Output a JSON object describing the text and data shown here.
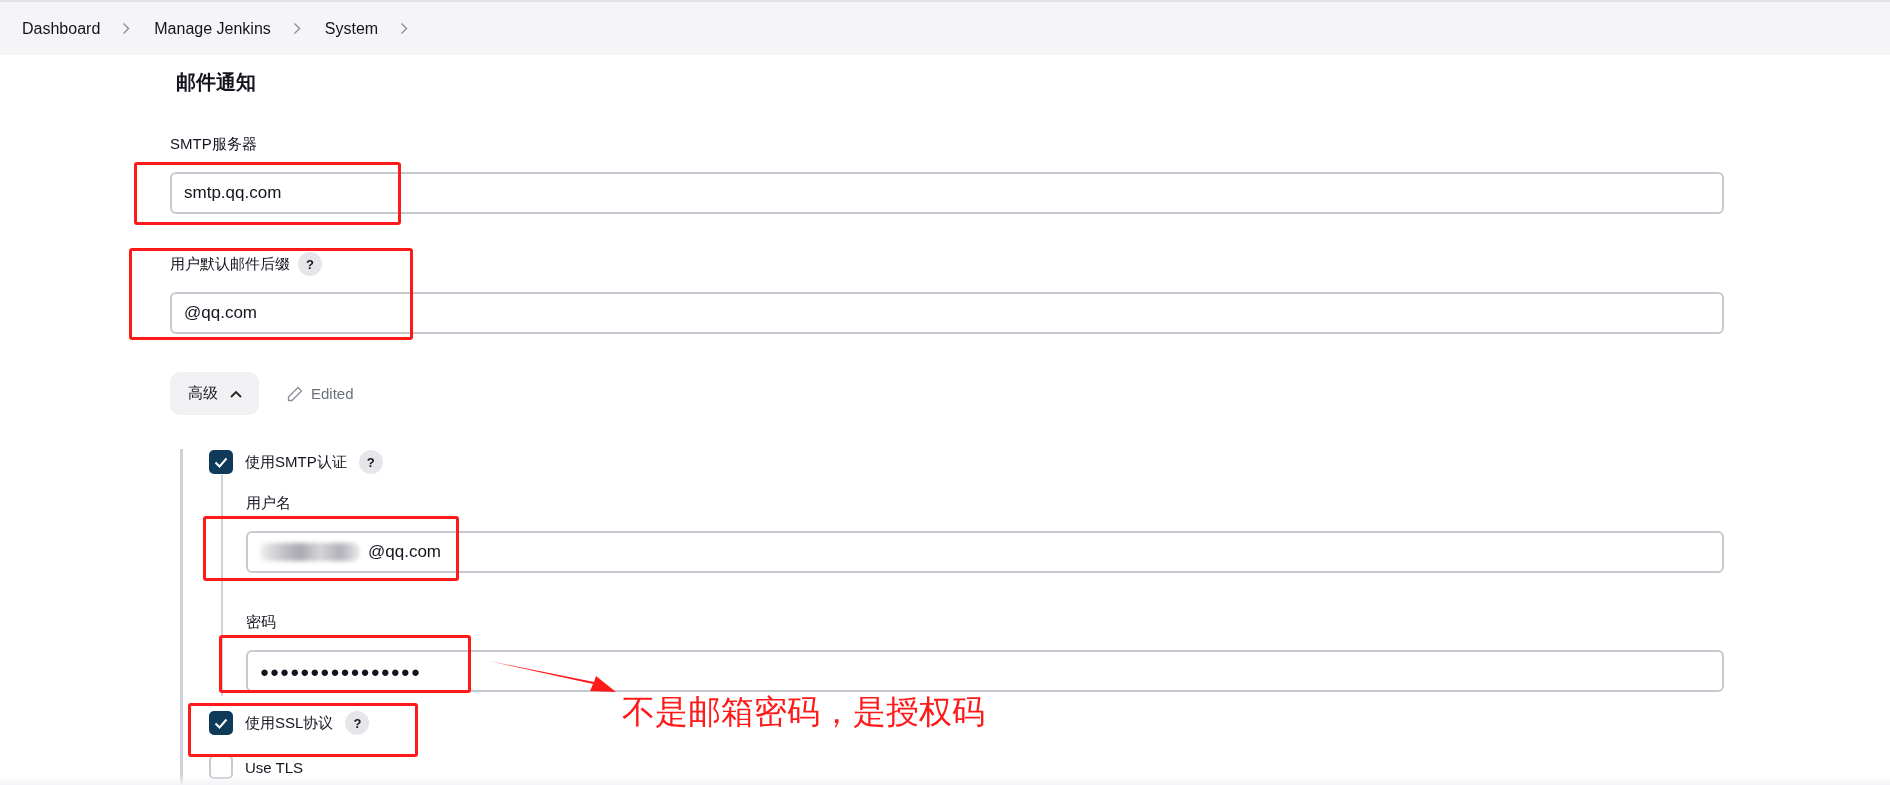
{
  "breadcrumbs": [
    {
      "label": "Dashboard"
    },
    {
      "label": "Manage Jenkins"
    },
    {
      "label": "System"
    }
  ],
  "section": {
    "title": "邮件通知"
  },
  "fields": [
    {
      "label": "SMTP服务器",
      "value": "smtp.qq.com"
    },
    {
      "label": "用户默认邮件后缀",
      "value": "@qq.com",
      "help": "?"
    }
  ],
  "advanced": {
    "label": "高级",
    "expanded": true,
    "status": "Edited"
  },
  "smtp_auth": {
    "label": "使用SMTP认证",
    "checked": true,
    "help": "?",
    "fields": [
      {
        "label": "用户名",
        "value": "@qq.com",
        "kind": "redacted"
      },
      {
        "label": "密码",
        "value": "●●●●●●●●●●●●●●●●",
        "kind": "password"
      }
    ]
  },
  "options": [
    {
      "label": "使用SSL协议",
      "checked": true,
      "help": "?"
    },
    {
      "label": "Use TLS",
      "checked": false
    }
  ],
  "annotation": {
    "note": "不是邮箱密码，是授权码"
  }
}
